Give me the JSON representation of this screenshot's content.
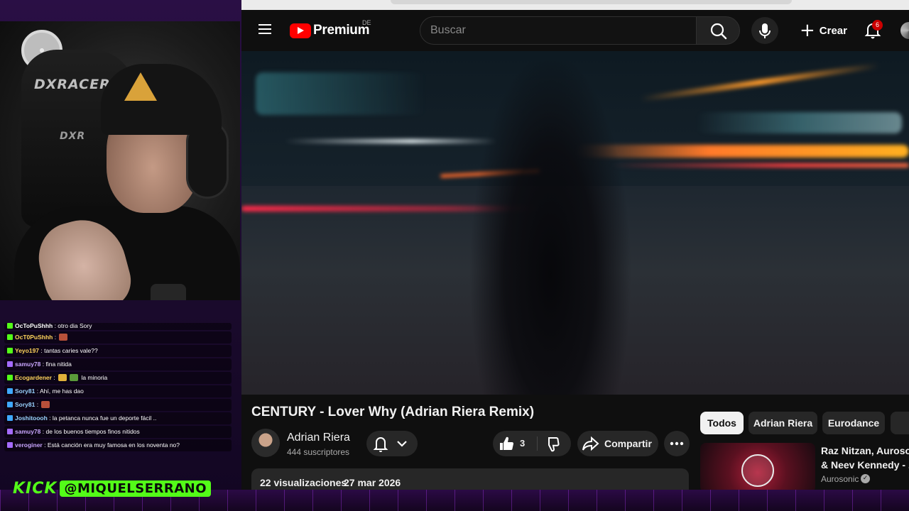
{
  "stream": {
    "chair_brand": "DXRACER",
    "chair_brand_lower": "DXR",
    "kick_logo": "KICK",
    "kick_handle": "@MIQUELSERRANO",
    "chat": [
      {
        "user": "OcToPuShhh",
        "message": "otro dia Sory",
        "emote": false,
        "badge_color": "#53fc18"
      },
      {
        "user": "OcT0PuShhh",
        "message": "",
        "emote": true,
        "badge_color": "#53fc18",
        "user_color": "#ffd45c"
      },
      {
        "user": "Yeyo197",
        "message": "tantas caries vale??",
        "emote": false,
        "badge_color": "#53fc18",
        "user_color": "#ffd45c"
      },
      {
        "user": "samuy78",
        "message": "fina nitida",
        "emote": false,
        "badge_color": "#a56bff",
        "user_color": "#c9a6ff"
      },
      {
        "user": "Ecogardener",
        "message": "la minoria",
        "emote": true,
        "badge_color": "#53fc18",
        "user_color": "#ffd45c"
      },
      {
        "user": "Sory81",
        "message": "Ahí, me has dao",
        "emote": false,
        "badge_color": "#3fa9ff",
        "user_color": "#9ad4ff"
      },
      {
        "user": "Sory81",
        "message": "",
        "emote": true,
        "badge_color": "#3fa9ff",
        "user_color": "#9ad4ff"
      },
      {
        "user": "Joshitoooh",
        "message": "la petanca nunca fue un deporte fácil ..",
        "emote": false,
        "badge_color": "#3fa9ff",
        "user_color": "#9ad4ff"
      },
      {
        "user": "samuy78",
        "message": "de los buenos tiempos finos nitidos",
        "emote": false,
        "badge_color": "#a56bff",
        "user_color": "#c9a6ff"
      },
      {
        "user": "veroginer",
        "message": "Está canción era muy famosa en los noventa no?",
        "emote": false,
        "badge_color": "#a56bff",
        "user_color": "#c9a6ff"
      }
    ]
  },
  "youtube": {
    "logo": "Premium",
    "country_code": "DE",
    "search": {
      "placeholder": "Buscar"
    },
    "create_label": "Crear",
    "notification_count": "6",
    "video": {
      "title": "CENTURY - Lover Why (Adrian Riera Remix)",
      "channel": "Adrian Riera",
      "subscribers": "444 suscriptores",
      "likes": "3",
      "share_label": "Compartir",
      "views": "22 visualizaciones",
      "date": "27 mar 2026"
    },
    "chips": [
      "Todos",
      "Adrian Riera",
      "Eurodance",
      ""
    ],
    "recommendation": {
      "title_line1": "Raz Nitzan, Aurosonic",
      "title_line2": "& Neev Kennedy - ...",
      "channel": "Aurosonic",
      "thumb_letter": "R"
    }
  },
  "colors": {
    "kick_green": "#53fc18",
    "yt_red": "#ff0000",
    "overlay_purple": "#2a0f45"
  }
}
